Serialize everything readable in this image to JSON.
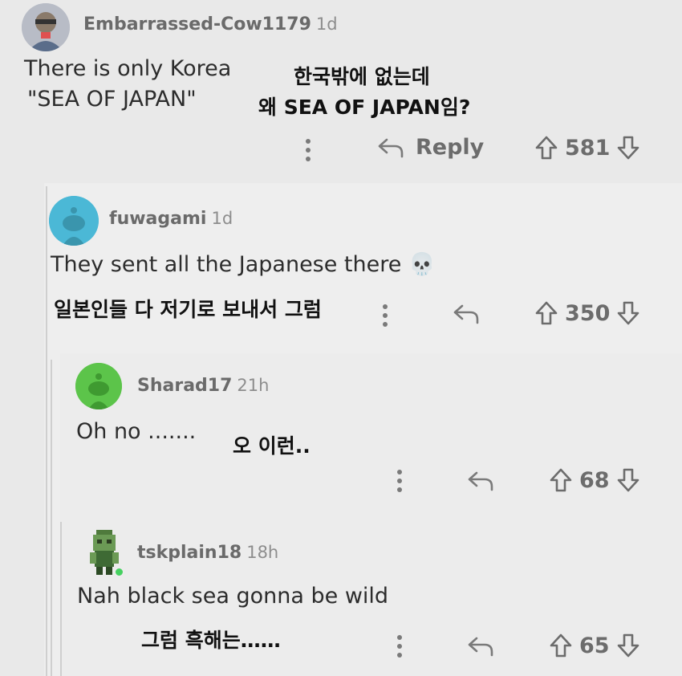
{
  "comments": [
    {
      "username": "Embarrassed-Cow1179",
      "age": "1d",
      "text_lines": [
        "There is only Korea",
        "\"SEA OF JAPAN\""
      ],
      "translation_lines": [
        "한국밖에 없는데",
        "왜 SEA OF JAPAN임?"
      ],
      "reply_label": "Reply",
      "score": "581",
      "avatar": "person-avatar-icon"
    },
    {
      "username": "fuwagami",
      "age": "1d",
      "text": "They sent all the Japanese there 💀",
      "translation": "일본인들 다 저기로 보내서 그럼",
      "score": "350",
      "avatar": "snoo-avatar-icon",
      "avatar_color": "#4bb8d6"
    },
    {
      "username": "Sharad17",
      "age": "21h",
      "text": "Oh no .......",
      "translation": "오 이런..",
      "score": "68",
      "avatar": "snoo-avatar-icon",
      "avatar_color": "#5cc44a"
    },
    {
      "username": "tskplain18",
      "age": "18h",
      "text": "Nah black sea gonna be wild",
      "translation": "그럼 흑해는……",
      "score": "65",
      "avatar": "pixel-character-avatar-icon",
      "online_color": "#46d160"
    }
  ],
  "icons": {
    "more": "kebab-icon",
    "reply": "reply-arrow-icon",
    "upvote": "upvote-arrow-icon",
    "downvote": "downvote-arrow-icon"
  }
}
